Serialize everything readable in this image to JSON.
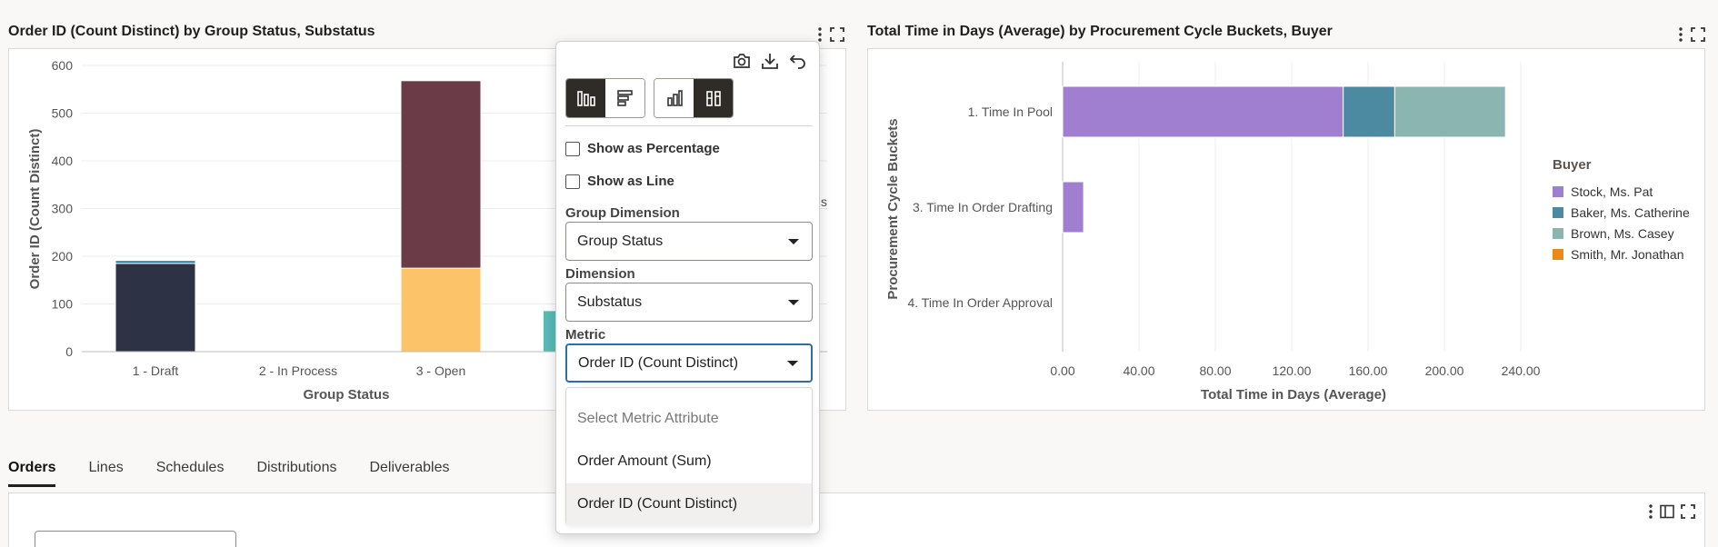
{
  "left_card": {
    "title": "Order ID (Count Distinct) by Group Status, Substatus",
    "peek_label": "s"
  },
  "right_card": {
    "title": "Total Time in Days (Average) by Procurement Cycle Buckets, Buyer"
  },
  "icons": {
    "more": "kebab-icon",
    "fullscreen": "expand-icon",
    "camera": "camera-icon",
    "download": "download-icon",
    "undo": "undo-icon"
  },
  "popup": {
    "show_percentage_label": "Show as Percentage",
    "show_line_label": "Show as Line",
    "group_dimension_label": "Group Dimension",
    "group_dimension_value": "Group Status",
    "dimension_label": "Dimension",
    "dimension_value": "Substatus",
    "metric_label": "Metric",
    "metric_value": "Order ID (Count Distinct)",
    "dropdown": {
      "header": "Select Metric Attribute",
      "options": [
        "Order Amount (Sum)",
        "Order ID (Count Distinct)"
      ],
      "selected": "Order ID (Count Distinct)"
    }
  },
  "tabs": [
    "Orders",
    "Lines",
    "Schedules",
    "Distributions",
    "Deliverables"
  ],
  "active_tab": "Orders",
  "chart_data": [
    {
      "type": "bar",
      "stacked": true,
      "orientation": "vertical",
      "title": "Order ID (Count Distinct) by Group Status, Substatus",
      "xlabel": "Group Status",
      "ylabel": "Order ID (Count Distinct)",
      "ylim": [
        0,
        600
      ],
      "yticks": [
        "0",
        "100",
        "200",
        "300",
        "400",
        "500",
        "600"
      ],
      "categories": [
        "1 - Draft",
        "2 - In Process",
        "3 - Open"
      ],
      "series": [
        {
          "color": "#2d3245",
          "values": [
            185,
            0,
            0
          ]
        },
        {
          "color": "#2e7d9a",
          "values": [
            6,
            0,
            0
          ]
        },
        {
          "color": "#fcc369",
          "values": [
            0,
            0,
            175
          ]
        },
        {
          "color": "#6b3b47",
          "values": [
            0,
            0,
            393
          ]
        }
      ],
      "partial_bar_value": 85,
      "partial_bar_color": "#5bbab5",
      "grid": true
    },
    {
      "type": "bar",
      "stacked": true,
      "orientation": "horizontal",
      "title": "Total Time in Days (Average) by Procurement Cycle Buckets, Buyer",
      "xlabel": "Total Time in Days (Average)",
      "ylabel": "Procurement Cycle Buckets",
      "xlim": [
        0,
        260
      ],
      "xticks": [
        "0.00",
        "40.00",
        "80.00",
        "120.00",
        "160.00",
        "200.00",
        "240.00"
      ],
      "categories": [
        "1. Time In Pool",
        "3. Time In Order Drafting",
        "4. Time In Order Approval"
      ],
      "legend_title": "Buyer",
      "legend_position": "right",
      "series": [
        {
          "name": "Stock, Ms. Pat",
          "color": "#a07fd0",
          "values": [
            147,
            11,
            0
          ]
        },
        {
          "name": "Baker, Ms. Catherine",
          "color": "#4b8aa0",
          "values": [
            27,
            0,
            0
          ]
        },
        {
          "name": "Brown, Ms. Casey",
          "color": "#8bb5b0",
          "values": [
            58,
            0,
            0
          ]
        },
        {
          "name": "Smith, Mr. Jonathan",
          "color": "#e8891a",
          "values": [
            0,
            0,
            0
          ]
        }
      ],
      "grid": true
    }
  ]
}
